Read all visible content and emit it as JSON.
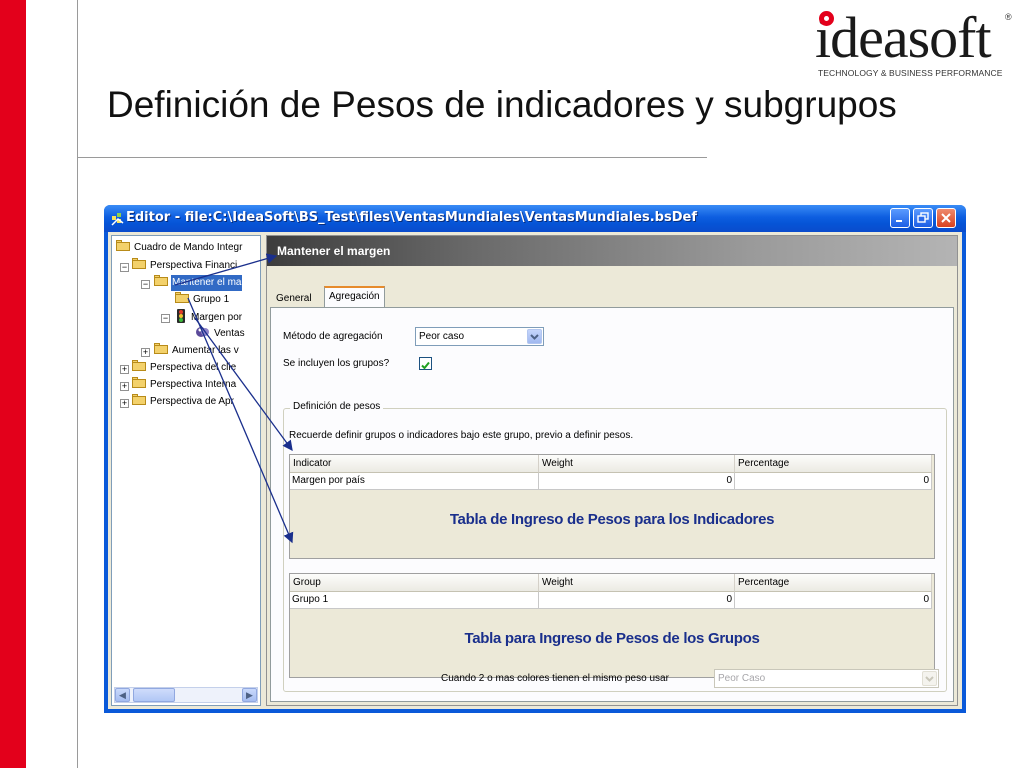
{
  "slide": {
    "title": "Definición de Pesos de indicadores y subgrupos",
    "logo_text": "ideasoft",
    "logo_tagline": "TECHNOLOGY & BUSINESS PERFORMANCE",
    "brand_color": "#e3001b"
  },
  "window": {
    "title": "Editor - file:C:\\IdeaSoft\\BS_Test\\files\\VentasMundiales\\VentasMundiales.bsDef",
    "buttons": [
      "minimize-icon",
      "restore-icon",
      "close-icon"
    ]
  },
  "tree": {
    "items": [
      {
        "label": "Cuadro de Mando Integr",
        "icon": "folder-icon"
      },
      {
        "label": "Perspectiva Financi",
        "icon": "folder-icon",
        "expander": "−"
      },
      {
        "label": "Mantener el ma",
        "icon": "folder-icon",
        "expander": "−",
        "selected": true
      },
      {
        "label": "Grupo 1",
        "icon": "folder-icon"
      },
      {
        "label": "Margen por",
        "icon": "traffic-light-icon",
        "expander": "−"
      },
      {
        "label": "Ventas",
        "icon": "indicator-icon"
      },
      {
        "label": "Aumentar las v",
        "icon": "folder-icon",
        "expander": "+"
      },
      {
        "label": "Perspectiva del clie",
        "icon": "folder-icon",
        "expander": "+"
      },
      {
        "label": "Perspectiva Interna",
        "icon": "folder-icon",
        "expander": "+"
      },
      {
        "label": "Perspectiva de Apr",
        "icon": "folder-icon",
        "expander": "+"
      }
    ]
  },
  "panel": {
    "header": "Mantener el margen",
    "tabs": [
      {
        "label": "General",
        "active": false
      },
      {
        "label": "Agregación",
        "active": true
      }
    ],
    "method_label": "Método de agregación",
    "method_value": "Peor caso",
    "include_groups_label": "Se incluyen los grupos?",
    "include_groups_checked": true,
    "weights_group_title": "Definición de pesos",
    "hint": "Recuerde definir grupos o indicadores bajo este grupo, previo a definir pesos.",
    "indicator_table": {
      "columns": [
        "Indicator",
        "Weight",
        "Percentage"
      ],
      "rows": [
        [
          "Margen por país",
          "0",
          "0"
        ]
      ],
      "annotation": "Tabla de Ingreso de Pesos para los Indicadores"
    },
    "group_table": {
      "columns": [
        "Group",
        "Weight",
        "Percentage"
      ],
      "rows": [
        [
          "Grupo 1",
          "0",
          "0"
        ]
      ],
      "annotation": "Tabla para Ingreso de Pesos de los Grupos"
    },
    "same_weight_label": "Cuando 2 o mas colores tienen el mismo peso usar",
    "same_weight_value": "Peor Caso"
  }
}
